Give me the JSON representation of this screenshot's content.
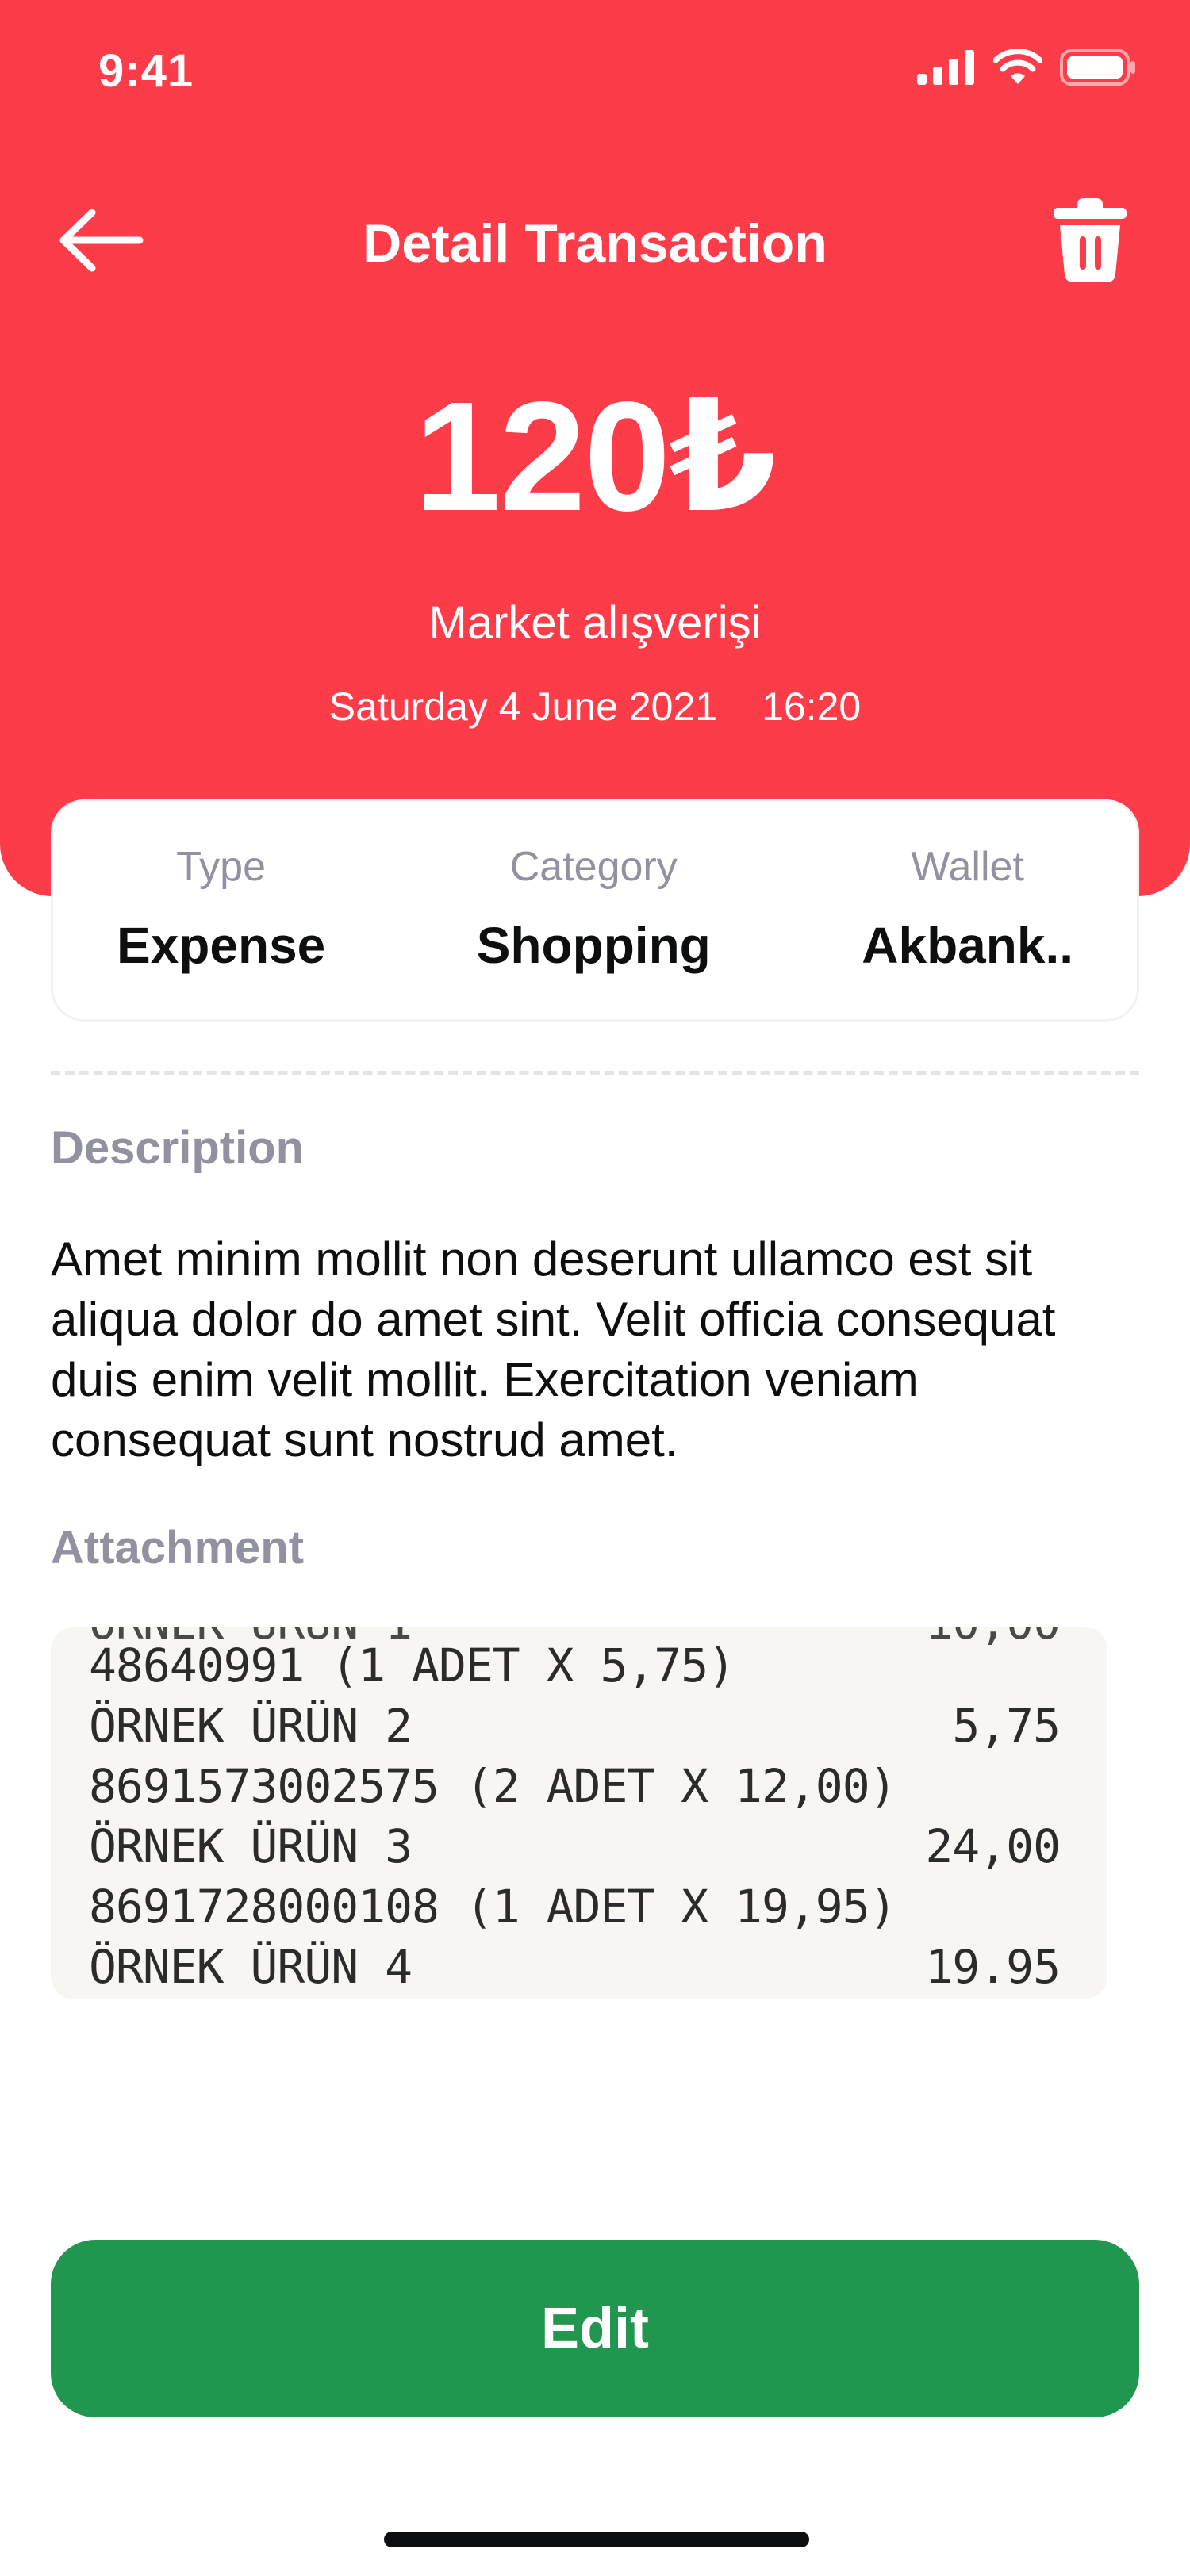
{
  "status_bar": {
    "time": "9:41"
  },
  "header": {
    "title": "Detail Transaction",
    "amount": "120₺",
    "transaction_name": "Market alışverişi",
    "date": "Saturday 4 June 2021",
    "time": "16:20",
    "background_color": "#fd3c4a"
  },
  "info_card": {
    "type_label": "Type",
    "type_value": "Expense",
    "category_label": "Category",
    "category_value": "Shopping",
    "wallet_label": "Wallet",
    "wallet_value": "Akbank.."
  },
  "description": {
    "label": "Description",
    "text": "Amet minim mollit non deserunt ullamco est sit aliqua dolor do amet sint. Velit officia consequat duis enim velit mollit. Exercitation veniam consequat sunt nostrud amet."
  },
  "attachment": {
    "label": "Attachment",
    "receipt_lines": [
      {
        "left": "48640991  (1 ADET X 5,75)",
        "right": ""
      },
      {
        "left": "ÖRNEK ÜRÜN 2",
        "right": "5,75"
      },
      {
        "left": "8691573002575  (2 ADET X 12,00)",
        "right": ""
      },
      {
        "left": "ÖRNEK ÜRÜN 3",
        "right": "24,00"
      },
      {
        "left": "8691728000108  (1 ADET X 19,95)",
        "right": ""
      },
      {
        "left": "ÖRNEK ÜRÜN 4",
        "right": "19.95"
      }
    ]
  },
  "edit_button": {
    "label": "Edit",
    "color": "#21964f"
  }
}
